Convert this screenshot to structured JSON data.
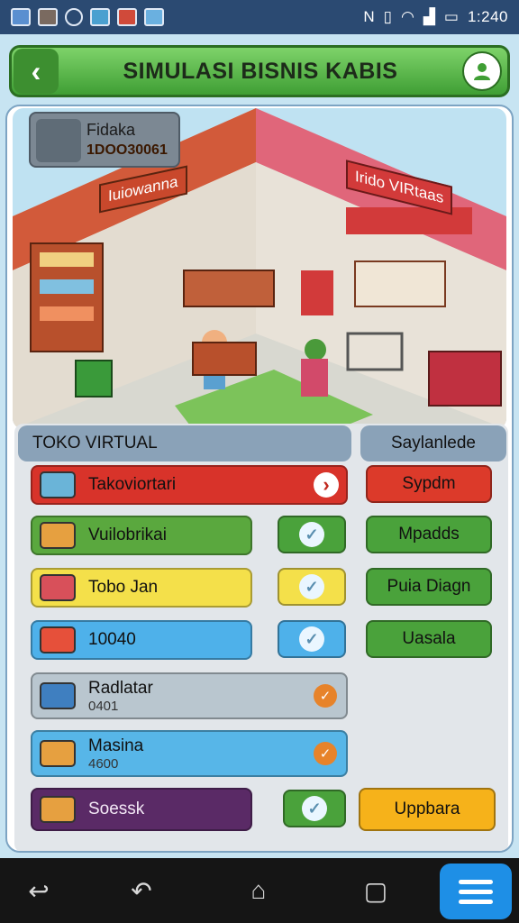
{
  "status_bar": {
    "time": "1:240",
    "icons": [
      "gallery-icon",
      "photos-icon",
      "clock-icon",
      "image-icon",
      "store-icon",
      "image-icon",
      "nfc-icon",
      "vibrate-icon",
      "wifi-icon",
      "signal-icon",
      "battery-icon"
    ]
  },
  "header": {
    "title": "SIMULASI BISNIS KABIS",
    "back_icon": "‹",
    "user_icon": "user-icon"
  },
  "scene": {
    "info_name": "Fidaka",
    "info_id": "1DOO30061",
    "store_sign_left": "Iuiowanna",
    "store_sign_right": "Irido VIRtaas"
  },
  "section": {
    "left_title": "TOKO VIRTUAL",
    "right_title": "Saylanlede"
  },
  "rows": [
    {
      "label": "Takoviortari",
      "sub": "",
      "bg": "#d8332a",
      "icon_color": "#6ab4d8",
      "indicator": "chevron"
    },
    {
      "label": "Vuilobrikai",
      "sub": "",
      "bg": "#5aa83e",
      "icon_color": "#e6a040",
      "indicator": "none"
    },
    {
      "label": "Tobo Jan",
      "sub": "",
      "bg": "#f4e04a",
      "icon_color": "#d8505a",
      "indicator": "none"
    },
    {
      "label": "10040",
      "sub": "",
      "bg": "#4eb1ea",
      "icon_color": "#e6503a",
      "indicator": "none"
    },
    {
      "label": "Radlatar",
      "sub": "0401",
      "bg": "#b9c6cf",
      "icon_color": "#3f7fc0",
      "indicator": "tick"
    },
    {
      "label": "Masina",
      "sub": "4600",
      "bg": "#57b6e8",
      "icon_color": "#e6a040",
      "indicator": "tick"
    },
    {
      "label": "Soessk",
      "sub": "",
      "bg": "#5a2a66",
      "icon_color": "#e6a040",
      "indicator": "none"
    }
  ],
  "checks": [
    {
      "bg": "#4aa23b"
    },
    {
      "bg": "#f4e04a"
    },
    {
      "bg": "#4eb1ea"
    },
    {
      "bg": "#4aa23b"
    }
  ],
  "side_buttons": [
    {
      "label": "Sypdm",
      "bg": "#dc3a2a"
    },
    {
      "label": "Mpadds",
      "bg": "#4aa23b"
    },
    {
      "label": "Puia Diagn",
      "bg": "#4aa23b"
    },
    {
      "label": "Uasala",
      "bg": "#4aa23b"
    }
  ],
  "action_button": {
    "label": "Uppbara",
    "bg": "#f6b21a"
  },
  "navbar": {
    "back": "↩",
    "undo": "↶",
    "home": "⌂",
    "recents": "▢"
  }
}
